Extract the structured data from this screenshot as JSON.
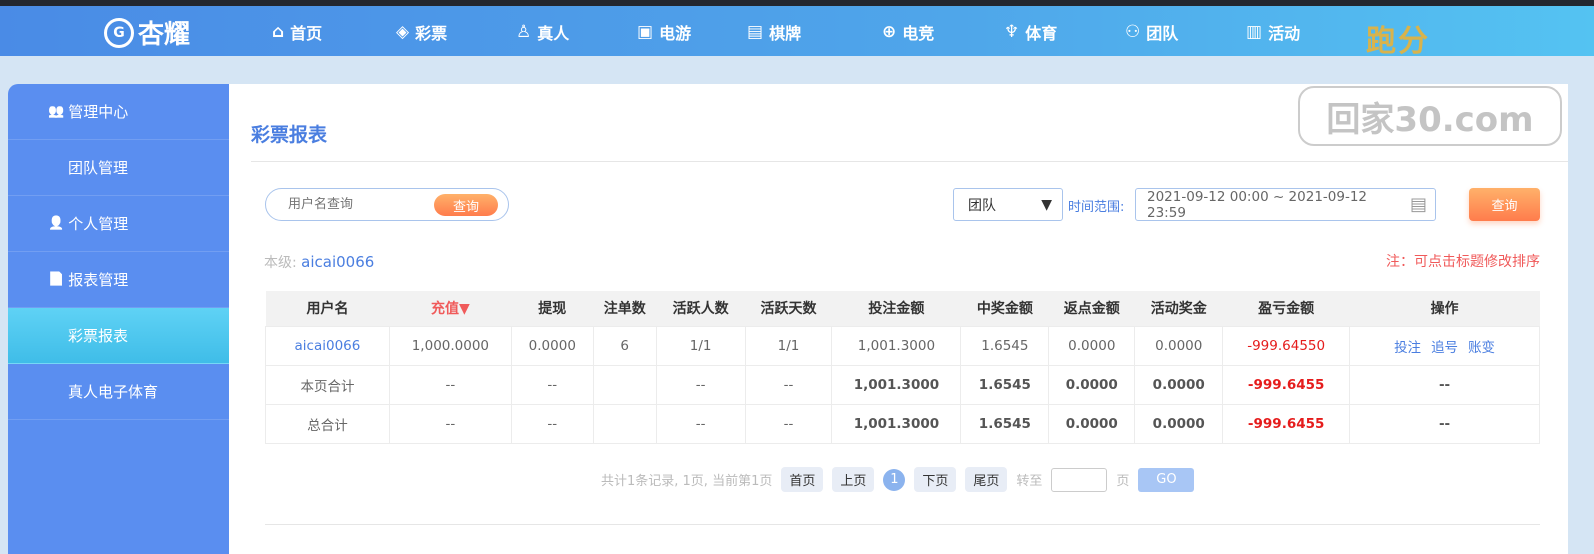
{
  "nav": {
    "logo": "杏耀",
    "logo_badge": "G",
    "items": [
      {
        "label": "首页",
        "icon": "home-icon",
        "glyph": "⌂"
      },
      {
        "label": "彩票",
        "icon": "ticket-icon",
        "glyph": "◈"
      },
      {
        "label": "真人",
        "icon": "person-icon",
        "glyph": "♙"
      },
      {
        "label": "电游",
        "icon": "slot-machine-icon",
        "glyph": "▣"
      },
      {
        "label": "棋牌",
        "icon": "card-icon",
        "glyph": "▤"
      },
      {
        "label": "电竞",
        "icon": "gamepad-icon",
        "glyph": "⊕"
      },
      {
        "label": "体育",
        "icon": "trophy-icon",
        "glyph": "♆"
      },
      {
        "label": "团队",
        "icon": "team-icon",
        "glyph": "⚇"
      },
      {
        "label": "活动",
        "icon": "gift-icon",
        "glyph": "▥"
      }
    ],
    "promo": "跑分"
  },
  "watermark": "回家30.com",
  "sidebar": {
    "items": [
      {
        "label": "管理中心",
        "type": "group",
        "icon": "team-icon",
        "glyph": "👥"
      },
      {
        "label": "团队管理",
        "type": "sub"
      },
      {
        "label": "个人管理",
        "type": "group",
        "icon": "user-icon",
        "glyph": "👤"
      },
      {
        "label": "报表管理",
        "type": "group",
        "icon": "report-icon",
        "glyph": "📄"
      },
      {
        "label": "彩票报表",
        "type": "sub",
        "active": true
      },
      {
        "label": "真人电子体育",
        "type": "sub"
      }
    ]
  },
  "main": {
    "title": "彩票报表",
    "search": {
      "placeholder": "用户名查询",
      "button": "查询"
    },
    "scope_select": "团队",
    "time_label": "时间范围:",
    "date_range": "2021-09-12 00:00 ~ 2021-09-12 23:59",
    "query_button": "查询",
    "level_label": "本级:",
    "level_user": "aicai0066",
    "note": "注：可点击标题修改排序",
    "table": {
      "headers": [
        "用户名",
        "充值▼",
        "提现",
        "注单数",
        "活跃人数",
        "活跃天数",
        "投注金额",
        "中奖金额",
        "返点金额",
        "活动奖金",
        "盈亏金额",
        "操作"
      ],
      "rows": [
        [
          "aicai0066",
          "1,000.0000",
          "0.0000",
          "6",
          "1/1",
          "1/1",
          "1,001.3000",
          "1.6545",
          "0.0000",
          "0.0000",
          "-999.64550"
        ],
        [
          "本页合计",
          "--",
          "--",
          "",
          "--",
          "--",
          "1,001.3000",
          "1.6545",
          "0.0000",
          "0.0000",
          "-999.6455",
          "--"
        ],
        [
          "总合计",
          "--",
          "--",
          "",
          "--",
          "--",
          "1,001.3000",
          "1.6545",
          "0.0000",
          "0.0000",
          "-999.6455",
          "--"
        ]
      ],
      "ops": [
        "投注",
        "追号",
        "账变"
      ]
    },
    "pager": {
      "summary": "共计1条记录,  1页, 当前第1页",
      "first": "首页",
      "prev": "上页",
      "current": "1",
      "next": "下页",
      "last": "尾页",
      "goto": "转至",
      "page_unit": "页",
      "go": "GO"
    }
  },
  "colors": {
    "accent": "#4a7ee0",
    "sidebar": "#5a8ef0",
    "loss": "#e51c1c",
    "orange": "#ff7c4c"
  }
}
